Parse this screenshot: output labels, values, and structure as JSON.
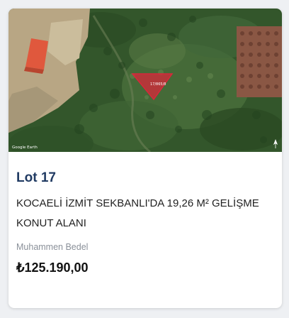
{
  "listing": {
    "lot_title": "Lot 17",
    "description": "KOCAELİ İZMİT SEKBANLI'DA 19,26 M² GELİŞME KONUT ALANI",
    "estimate_label": "Muhammen Bedel",
    "price": "₺125.190,00"
  },
  "map": {
    "attribution": "Google Earth",
    "parcel_label": "17/865/8",
    "north_icon": "north-arrow-icon",
    "parcel_color": "#d8283a",
    "building_color": "#e2563b"
  }
}
